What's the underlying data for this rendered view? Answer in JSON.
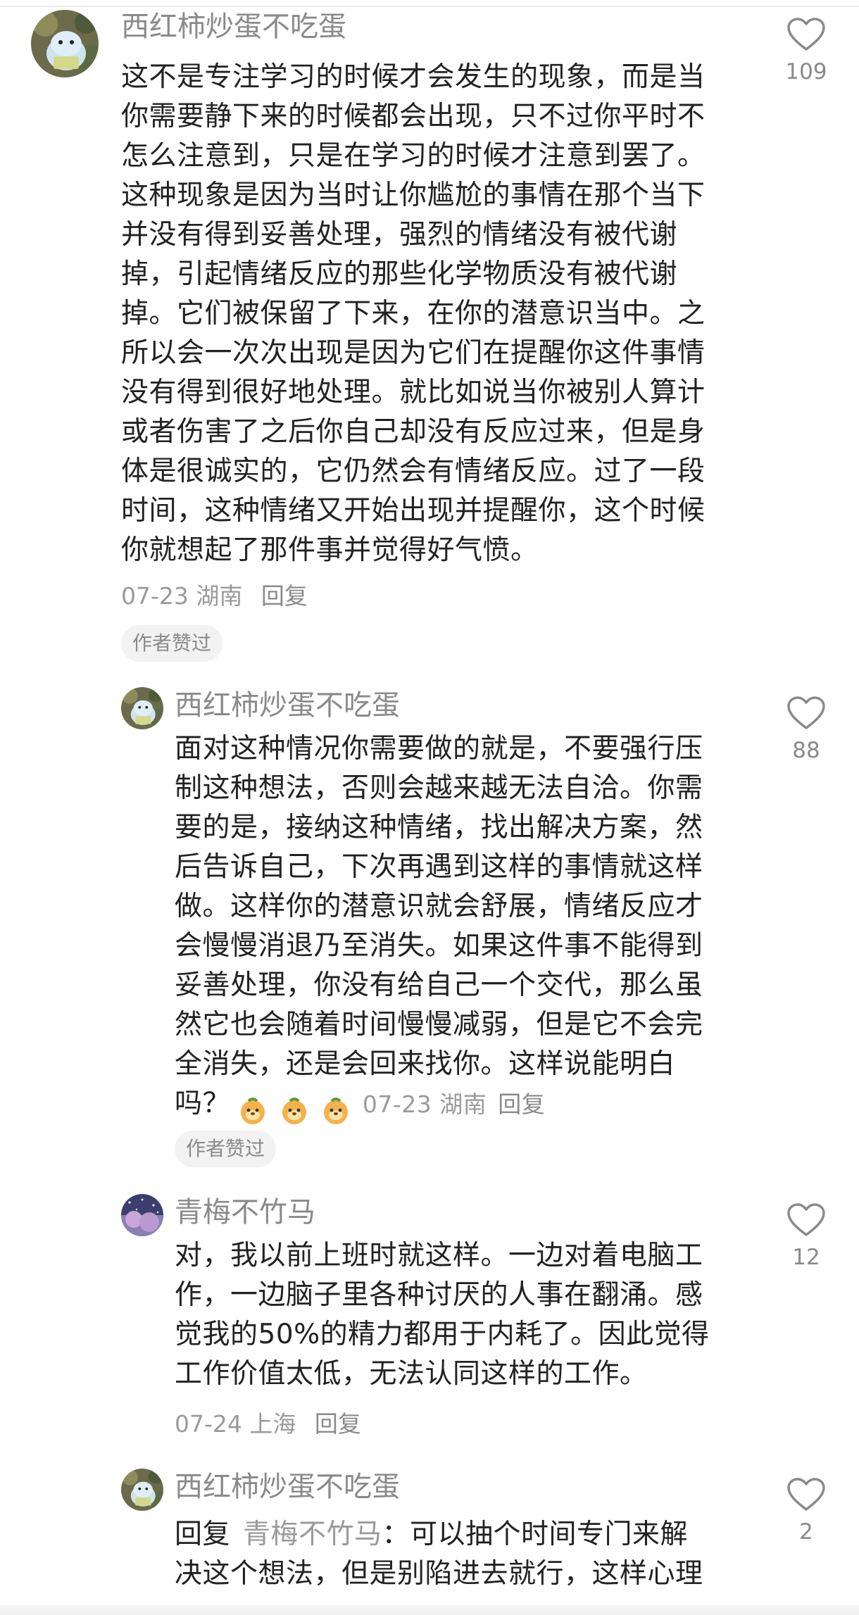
{
  "comments": [
    {
      "username": "西红柿炒蛋不吃蛋",
      "lines": [
        "这不是专注学习的时候才会发生的现象，而是当",
        "你需要静下来的时候都会出现，只不过你平时不",
        "怎么注意到，只是在学习的时候才注意到罢了。",
        "这种现象是因为当时让你尴尬的事情在那个当下",
        "并没有得到妥善处理，强烈的情绪没有被代谢",
        "掉，引起情绪反应的那些化学物质没有被代谢",
        "掉。它们被保留了下来，在你的潜意识当中。之",
        "所以会一次次出现是因为它们在提醒你这件事情",
        "没有得到很好地处理。就比如说当你被别人算计",
        "或者伤害了之后你自己却没有反应过来，但是身",
        "体是很诚实的，它仍然会有情绪反应。过了一段",
        "时间，这种情绪又开始出现并提醒你，这个时候",
        "你就想起了那件事并觉得好气愤。"
      ],
      "date": "07-23",
      "location": "湖南",
      "reply_label": "回复",
      "badge": "作者赞过",
      "likes": "109"
    },
    {
      "username": "西红柿炒蛋不吃蛋",
      "lines": [
        "面对这种情况你需要做的就是，不要强行压",
        "制这种想法，否则会越来越无法自洽。你需",
        "要的是，接纳这种情绪，找出解决方案，然",
        "后告诉自己，下次再遇到这样的事情就这样",
        "做。这样你的潜意识就会舒展，情绪反应才",
        "会慢慢消退乃至消失。如果这件事不能得到",
        "妥善处理，你没有给自己一个交代，那么虽",
        "然它也会随着时间慢慢减弱，但是它不会完",
        "全消失，还是会回来找你。这样说能明白"
      ],
      "last_line": "吗？",
      "emoji_icon": "orange-doge-emoji",
      "date": "07-23",
      "location": "湖南",
      "reply_label": "回复",
      "badge": "作者赞过",
      "likes": "88"
    },
    {
      "username": "青梅不竹马",
      "lines": [
        "对，我以前上班时就这样。一边对着电脑工",
        "作，一边脑子里各种讨厌的人事在翻涌。感",
        "觉我的50%的精力都用于内耗了。因此觉得",
        "工作价值太低，无法认同这样的工作。"
      ],
      "date": "07-24",
      "location": "上海",
      "reply_label": "回复",
      "likes": "12"
    },
    {
      "username": "西红柿炒蛋不吃蛋",
      "reply_prefix": "回复",
      "mention": "青梅不竹马",
      "first_line_rest": "：可以抽个时间专门来解",
      "lines": [
        "决这个想法，但是别陷进去就行，这样心理"
      ],
      "likes": "2"
    }
  ],
  "colors": {
    "username": "#8a8a8a",
    "body": "#222222",
    "meta": "#9a9a9a",
    "badge_bg": "#f2f2f2",
    "heart_stroke": "#8a8a8a"
  },
  "icons": {
    "like": "heart-outline-icon",
    "avatar_1": "cartoon-avatar",
    "avatar_2": "night-sky-avatar"
  }
}
